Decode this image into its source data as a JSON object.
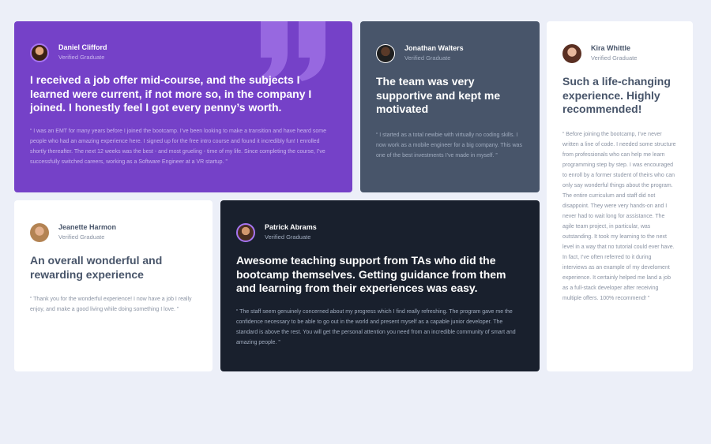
{
  "testimonials": [
    {
      "name": "Daniel Clifford",
      "role": "Verified Graduate",
      "headline": "I received a job offer mid-course, and the subjects I learned were current, if not more so, in the company I joined. I honestly feel I got every penny’s worth.",
      "quote": "“ I was an EMT for many years before I joined the bootcamp. I’ve been looking to make a transition and have heard some people who had an amazing experience here. I signed up for the free intro course and found it incredibly fun! I enrolled shortly thereafter. The next 12 weeks was the best - and most grueling - time of my life. Since completing the course, I’ve successfully switched careers, working as a Software Engineer at a VR startup. ”"
    },
    {
      "name": "Jonathan Walters",
      "role": "Verified Graduate",
      "headline": "The team was very supportive and kept me motivated",
      "quote": "“ I started as a total newbie with virtually no coding skills. I now work as a mobile engineer for a big company. This was one of the best investments I’ve made in myself. ”"
    },
    {
      "name": "Kira Whittle",
      "role": "Verified Graduate",
      "headline": "Such a life-changing experience. Highly recommended!",
      "quote": "“ Before joining the bootcamp, I’ve never written a line of code. I needed some structure from professionals who can help me learn programming step by step. I was encouraged to enroll by a former student of theirs who can only say wonderful things about the program. The entire curriculum and staff did not disappoint. They were very hands-on and I never had to wait long for assistance. The agile team project, in particular, was outstanding. It took my learning to the next level in a way that no tutorial could ever have. In fact, I’ve often referred to it during interviews as an example of my develoment experience. It certainly helped me land a job as a full-stack developer after receiving multiple offers. 100% recommend! ”"
    },
    {
      "name": "Jeanette Harmon",
      "role": "Verified Graduate",
      "headline": "An overall wonderful and rewarding experience",
      "quote": "“ Thank you for the wonderful experience! I now have a job I really enjoy, and make a good living while doing something I love. ”"
    },
    {
      "name": "Patrick Abrams",
      "role": "Verified Graduate",
      "headline": "Awesome teaching support from TAs who did the bootcamp themselves. Getting guidance from them and learning from their experiences was easy.",
      "quote": "“ The staff seem genuinely concerned about my progress which I find really refreshing. The program gave me the confidence necessary to be able to go out in the world and present myself as a capable junior developer. The standard is above the rest. You will get the personal attention you need from an incredible community of smart and amazing people. ”"
    }
  ],
  "theme": {
    "background": "#eceff8",
    "purple": "#7541c8",
    "grey_blue": "#48556a",
    "dark_navy": "#19202d",
    "white": "#ffffff",
    "accent_purple": "#a775f1"
  },
  "icons": {
    "quote_mark": "quotation-mark-icon"
  }
}
